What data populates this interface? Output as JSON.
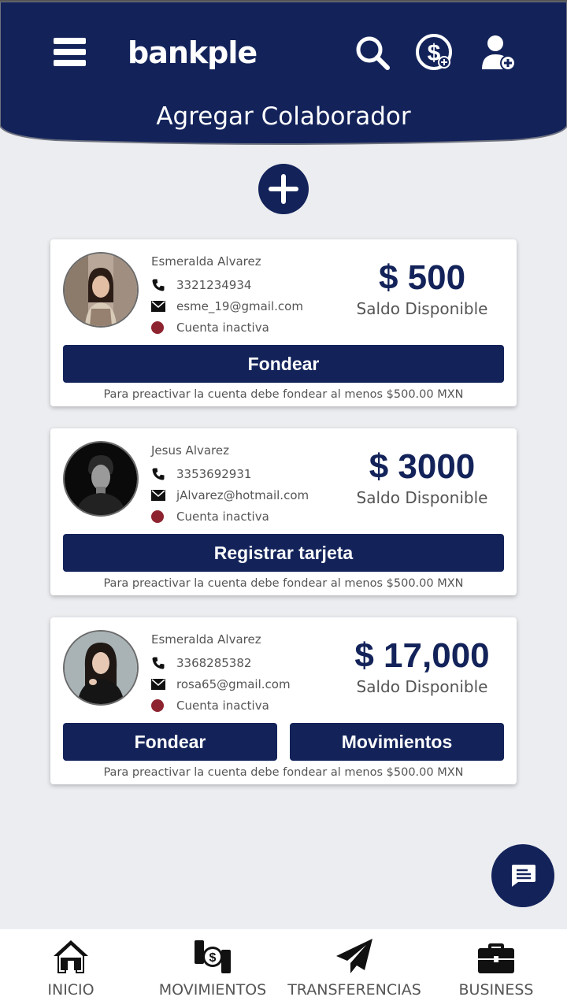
{
  "header": {
    "logo": "bankple",
    "title": "Agregar Colaborador"
  },
  "colors": {
    "primary": "#13235a",
    "inactive": "#8e2330",
    "background": "#ecedf0"
  },
  "collaborators": [
    {
      "name": "Esmeralda Alvarez",
      "phone": "3321234934",
      "email": "esme_19@gmail.com",
      "status": "Cuenta inactiva",
      "amount": "$ 500",
      "balance_label": "Saldo Disponible",
      "actions": [
        "Fondear"
      ],
      "note": "Para preactivar la cuenta debe fondear al menos $500.00 MXN"
    },
    {
      "name": "Jesus Alvarez",
      "phone": "3353692931",
      "email": "jAlvarez@hotmail.com",
      "status": "Cuenta inactiva",
      "amount": "$ 3000",
      "balance_label": "Saldo Disponible",
      "actions": [
        "Registrar tarjeta"
      ],
      "note": "Para preactivar la cuenta debe fondear al menos $500.00 MXN"
    },
    {
      "name": "Esmeralda Alvarez",
      "phone": "3368285382",
      "email": "rosa65@gmail.com",
      "status": "Cuenta inactiva",
      "amount": "$ 17,000",
      "balance_label": "Saldo Disponible",
      "actions": [
        "Fondear",
        "Movimientos"
      ],
      "note": "Para preactivar la cuenta debe fondear al menos $500.00 MXN"
    }
  ],
  "nav": [
    {
      "label": "INICIO",
      "icon": "home-icon"
    },
    {
      "label": "MOVIMIENTOS",
      "icon": "money-exchange-icon"
    },
    {
      "label": "TRANSFERENCIAS",
      "icon": "paper-plane-icon"
    },
    {
      "label": "BUSINESS",
      "icon": "briefcase-icon"
    }
  ]
}
